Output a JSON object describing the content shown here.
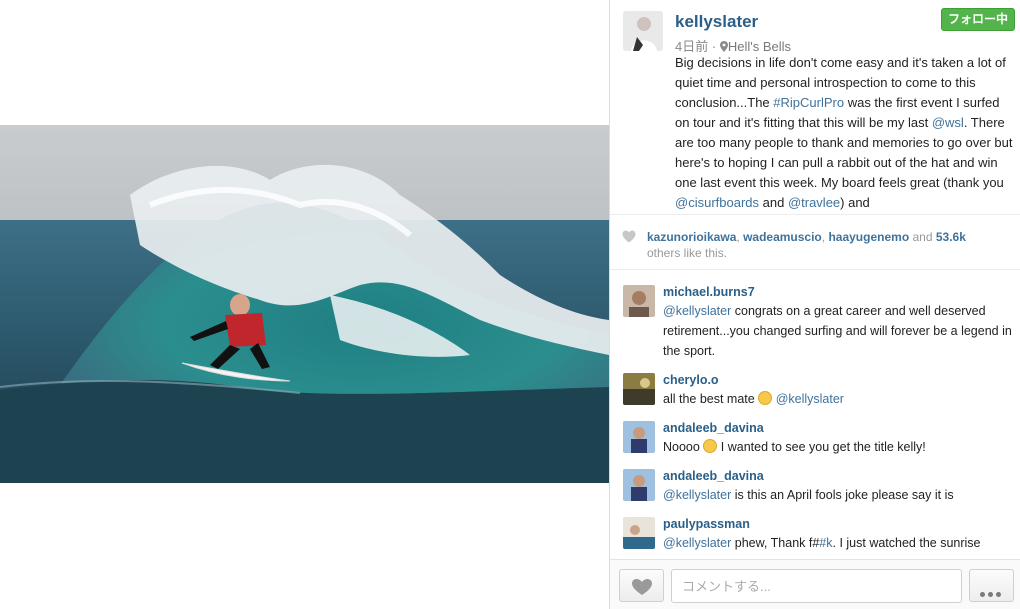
{
  "post": {
    "username": "kellyslater",
    "follow_label": "フォロー中",
    "time": "4日前",
    "separator": "·",
    "location": "Hell's Bells",
    "caption": {
      "p1": "Big decisions in life don't come easy and it's taken a lot of quiet time and personal introspection to come to this conclusion...The ",
      "tag1": "#RipCurlPro",
      "p2": " was the first event I surfed on tour and it's fitting that this will be my last ",
      "tag2": "@wsl",
      "p3": ". There are too many people to thank and memories to go over but here's to hoping I can pull a rabbit out of the hat and win one last event this week. My board feels great (thank you ",
      "tag3": "@cisurfboards",
      "p4": " and ",
      "tag4": "@travlee",
      "p5": ") and"
    }
  },
  "likes": {
    "user1": "kazunorioikawa",
    "user2": "wadeamuscio",
    "user3": "haayugenemo",
    "comma": ",",
    "and": "and",
    "count": "53.6k",
    "suffix": "others like this."
  },
  "comments": [
    {
      "user": "michael.burns7",
      "mention": "@kellyslater",
      "text": " congrats on a great career and well deserved retirement...you changed surfing and will forever be a legend in the sport."
    },
    {
      "user": "cherylo.o",
      "text": "all the best mate ",
      "emoji": "relieved-face-emoji",
      "mention": "@kellyslater"
    },
    {
      "user": "andaleeb_davina",
      "text_a": "Noooo ",
      "emoji": "crying-face-emoji",
      "text_b": " I wanted to see you get the title kelly!"
    },
    {
      "user": "andaleeb_davina",
      "mention": "@kellyslater",
      "text": " is this an April fools joke please say it is"
    },
    {
      "user": "paulypassman",
      "mention": "@kellyslater",
      "text_a": " phew, Thank f#",
      "tag": "#k",
      "text_b": ". I just watched the sunrise"
    }
  ],
  "footer": {
    "comment_placeholder": "コメントする...",
    "like_icon": "heart-icon",
    "more_icon": "more-dots-icon"
  },
  "colors": {
    "username": "#2a5f89",
    "link": "#3f729b",
    "follow_green": "#52b44a"
  }
}
